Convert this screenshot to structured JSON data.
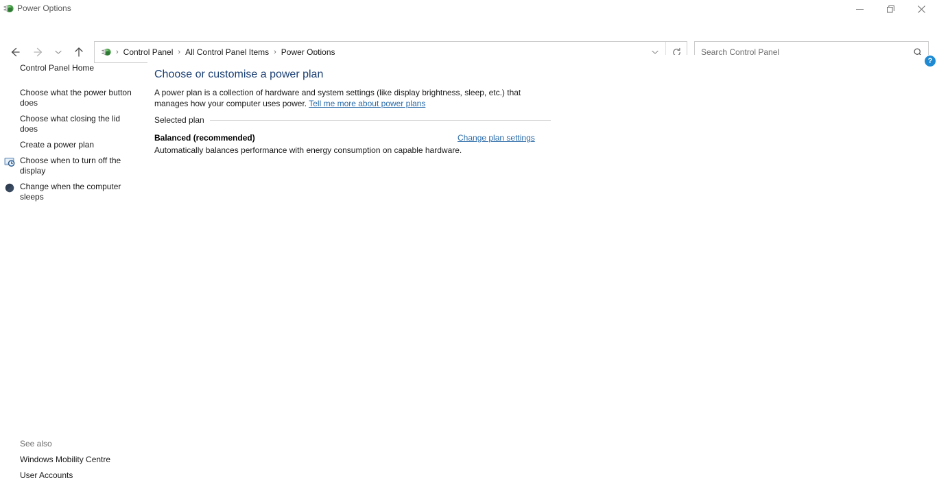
{
  "window": {
    "title": "Power Options",
    "app_icon": "power-plug-icon",
    "controls": {
      "minimize": "minimize-icon",
      "maximize": "restore-icon",
      "close": "close-icon"
    }
  },
  "navigation": {
    "back": "back-arrow-icon",
    "forward": "forward-arrow-icon",
    "recent": "recent-locations-chevron-icon",
    "up": "up-arrow-icon",
    "address_icon": "power-plug-icon",
    "breadcrumbs": [
      {
        "label": "Control Panel"
      },
      {
        "label": "All Control Panel Items"
      },
      {
        "label": "Power Options"
      }
    ],
    "separator": "›",
    "history_dropdown": "chevron-down-icon",
    "refresh": "refresh-icon"
  },
  "search": {
    "placeholder": "Search Control Panel",
    "value": "",
    "icon": "search-icon"
  },
  "sidebar": {
    "home_label": "Control Panel Home",
    "items": [
      {
        "label": "Choose what the power button does",
        "icon": null
      },
      {
        "label": "Choose what closing the lid does",
        "icon": null
      },
      {
        "label": "Create a power plan",
        "icon": null
      },
      {
        "label": "Choose when to turn off the display",
        "icon": "display-clock-icon"
      },
      {
        "label": "Change when the computer sleeps",
        "icon": "sleep-moon-icon"
      }
    ],
    "see_also": {
      "heading": "See also",
      "links": [
        {
          "label": "Windows Mobility Centre"
        },
        {
          "label": "User Accounts"
        }
      ]
    }
  },
  "main": {
    "heading": "Choose or customise a power plan",
    "description_part1": "A power plan is a collection of hardware and system settings (like display brightness, sleep, etc.) that manages how your computer uses power. ",
    "description_link": "Tell me more about power plans",
    "section_label": "Selected plan",
    "plan": {
      "name": "Balanced (recommended)",
      "description": "Automatically balances performance with energy consumption on capable hardware.",
      "change_link": "Change plan settings"
    },
    "help_label": "?"
  },
  "colors": {
    "heading": "#1b3f73",
    "link": "#2a6ba8",
    "help_badge": "#1f8ad2",
    "border": "#cccccc",
    "rule": "#d4d4d4"
  }
}
